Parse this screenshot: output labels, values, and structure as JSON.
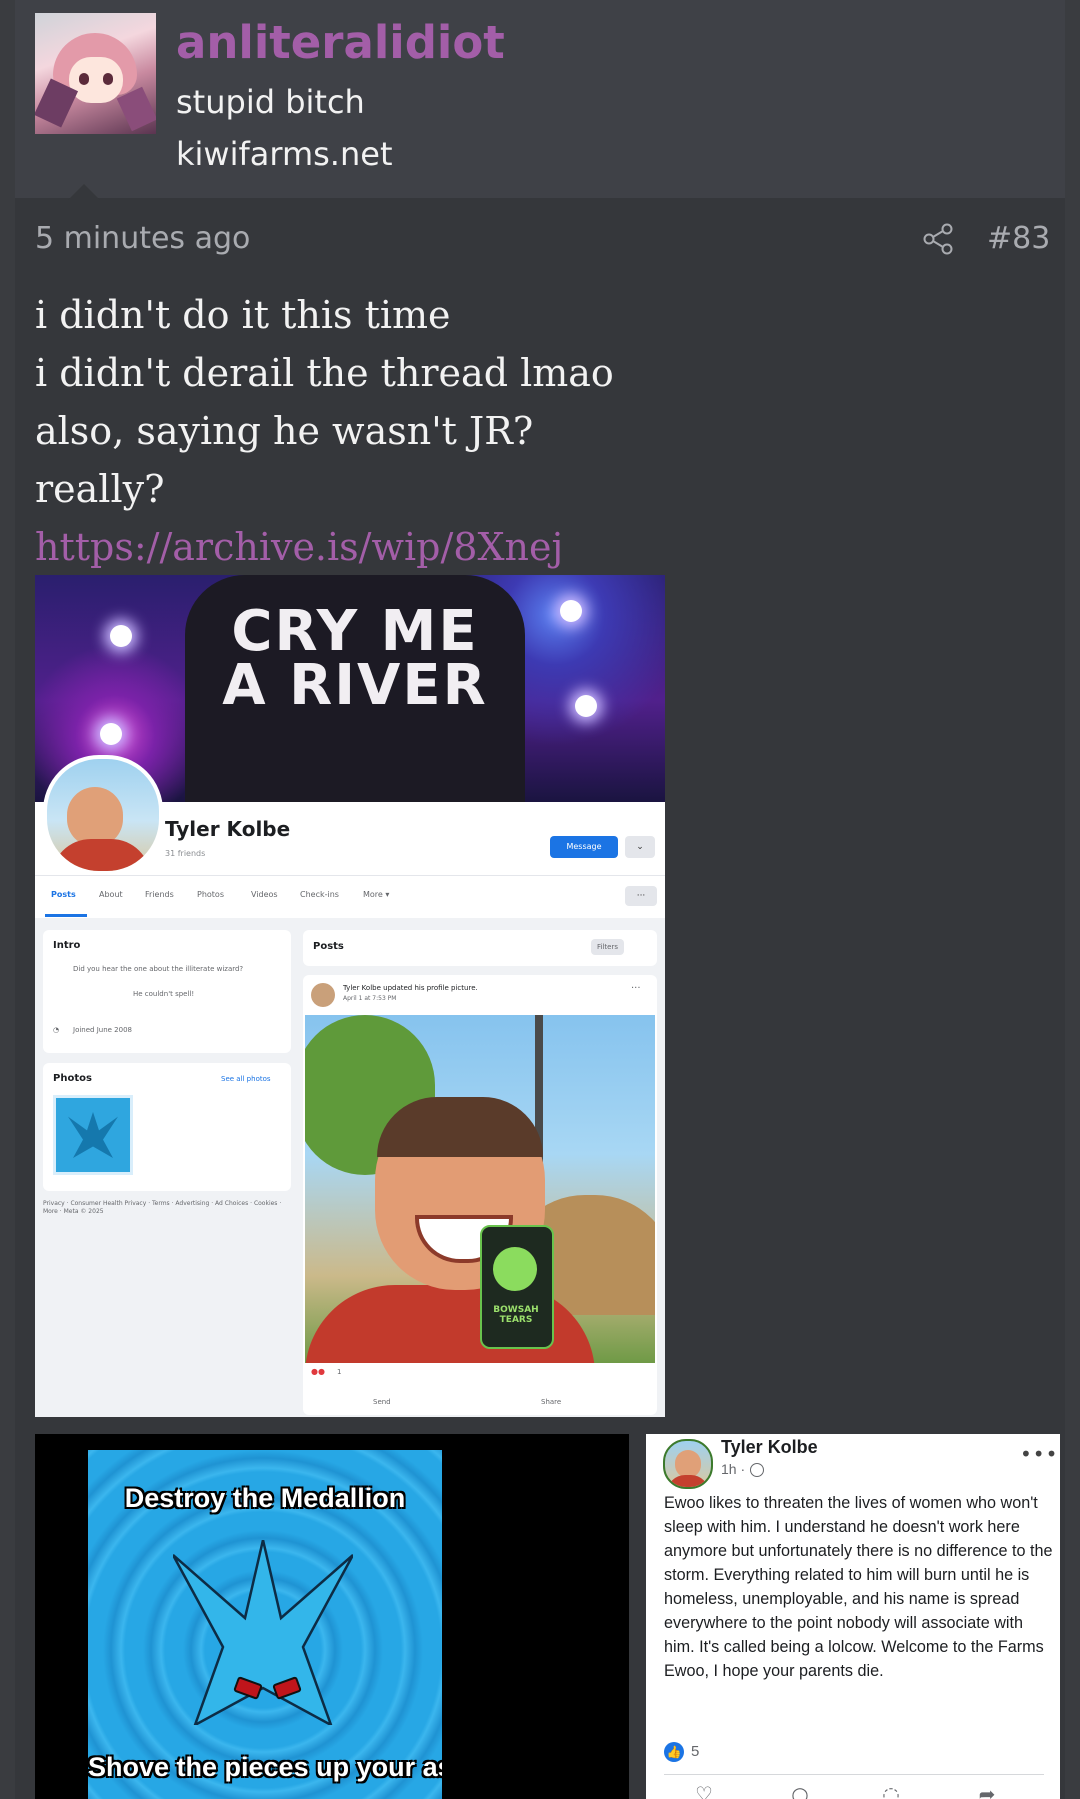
{
  "author": {
    "username": "anliteralidiot",
    "title": "stupid bitch",
    "site": "kiwifarms.net"
  },
  "post": {
    "time": "5 minutes ago",
    "number": "#83",
    "lines": [
      "i didn't do it this time",
      "i didn't derail the thread lmao",
      "also, saying he wasn't JR?",
      "really?"
    ],
    "link": "https://archive.is/wip/8Xnej"
  },
  "image1": {
    "cover_text": "CRY ME A RIVER",
    "profile_name": "Tyler Kolbe",
    "friends": "31 friends",
    "message_btn": "Message",
    "tabs": [
      "Posts",
      "About",
      "Friends",
      "Photos",
      "Videos",
      "Check-ins",
      "More ▾"
    ],
    "intro_title": "Intro",
    "intro_text_1": "Did you hear the one about the illiterate wizard?",
    "intro_text_2": "He couldn't spell!",
    "joined": "Joined June 2008",
    "photos_title": "Photos",
    "see_all": "See all photos",
    "footer": "Privacy · Consumer Health Privacy · Terms · Advertising · Ad Choices · Cookies · More · Meta © 2025",
    "posts_title": "Posts",
    "filters": "Filters",
    "post_author": "Tyler Kolbe updated his profile picture.",
    "post_date": "April 1 at 7:53 PM",
    "can_text": "BOWSAH TEARS",
    "reaction_count": "1",
    "send": "Send",
    "share": "Share"
  },
  "image2": {
    "meme_top": "Destroy the Medallion",
    "meme_bottom": "Shove the pieces up your ass"
  },
  "image3": {
    "name": "Tyler Kolbe",
    "time": "1h ·",
    "text": "Ewoo likes to threaten the lives of women who won't sleep with him. I understand he doesn't work here anymore but unfortunately there is no difference to the storm. Everything related to him will burn until he is homeless, unemployable, and his name is spread everywhere to the point nobody will associate with him. It's called being a lolcow. Welcome to the Farms Ewoo, I hope your parents die.",
    "likes": "5"
  },
  "colors": {
    "accent": "#a35ea8",
    "background": "#35373b",
    "header": "#3f4147"
  }
}
